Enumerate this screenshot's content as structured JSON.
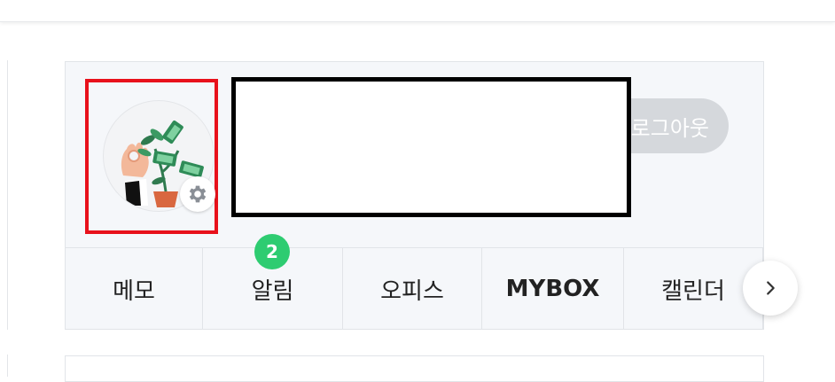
{
  "profile": {
    "avatar_icon": "money-plant-illustration",
    "settings_icon": "gear-icon"
  },
  "logout": {
    "label": "로그아웃"
  },
  "tabs": [
    {
      "label": "메모",
      "bold": false
    },
    {
      "label": "알림",
      "bold": false
    },
    {
      "label": "오피스",
      "bold": false
    },
    {
      "label": "MYBOX",
      "bold": true
    },
    {
      "label": "캘린더",
      "bold": false
    }
  ],
  "notifications": {
    "badge_count": "2"
  },
  "nav": {
    "next_icon": "chevron-right-icon"
  },
  "colors": {
    "highlight_border": "#e8111b",
    "badge": "#2ecc71",
    "logout_bg": "#d5d8dc"
  }
}
